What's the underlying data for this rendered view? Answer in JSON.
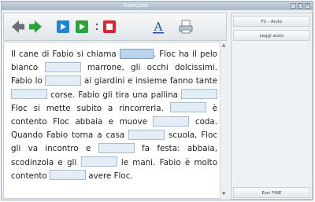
{
  "window": {
    "title": "Esercizio"
  },
  "toolbar": {
    "icons": [
      "back-arrow-icon",
      "forward-arrow-icon",
      "previous-page-icon",
      "next-page-icon",
      "stop-icon",
      "font-icon",
      "print-icon"
    ]
  },
  "sidebar": {
    "help_label": "F1 - Aiuto",
    "read_help_label": "Leggi aiuto",
    "exit_label": "Esci FINE"
  },
  "exercise": {
    "segments": [
      "Il cane di Fabio si chiama ",
      ". Floc ha il pelo bianco ",
      " marrone, gli occhi dolcissimi. Fabio lo ",
      " ai giardini e insieme fanno tante ",
      " corse. Fabio gli tira una pallina ",
      " Floc si mette subito a rincorrerla. ",
      " è contento Floc abbaia e muove ",
      " coda. Quando Fabio torna a casa ",
      " scuola, Floc gli va incontro e ",
      " fa festa: abbaia, scodinzola e gli ",
      " le mani. Fabio è molto contento ",
      " avere Floc."
    ],
    "blank_values": [
      "",
      "",
      "",
      "",
      "",
      "",
      "",
      "",
      "",
      "",
      ""
    ]
  },
  "colors": {
    "accent_blue": "#1d86d6",
    "green": "#2aa43a",
    "red": "#d7262c",
    "blank_fill": "#e4edf6"
  }
}
